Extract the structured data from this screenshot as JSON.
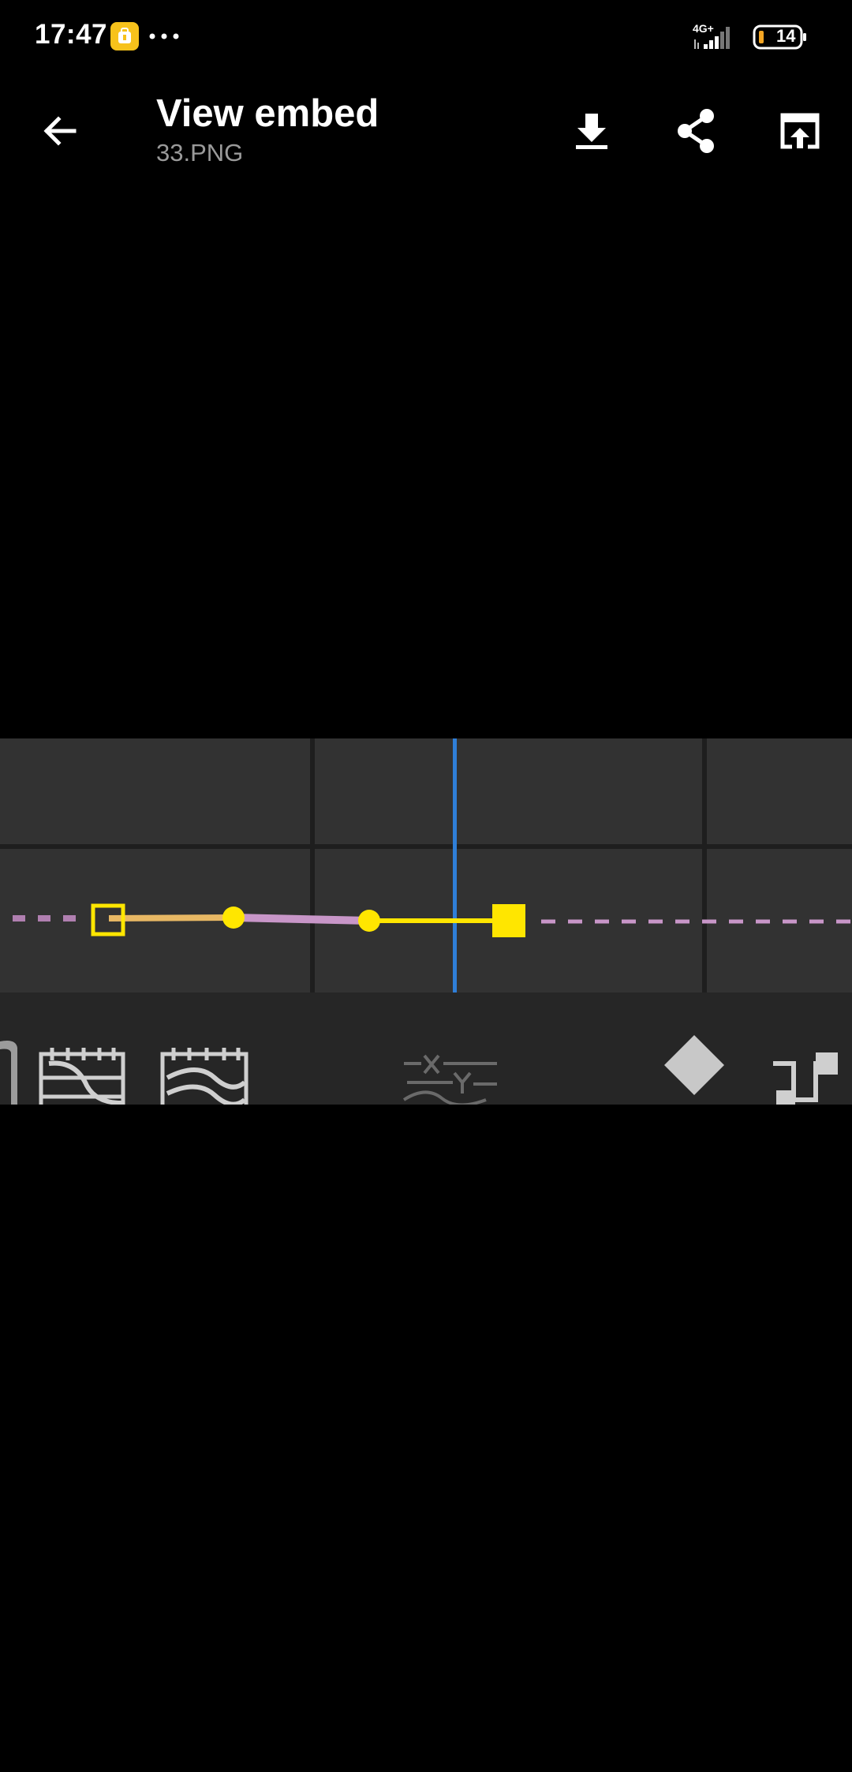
{
  "status_bar": {
    "time": "17:47",
    "network_type": "4G+",
    "battery_level": "14",
    "icons": [
      "app-notification-icon",
      "more-dots-icon",
      "signal-icon",
      "battery-icon"
    ]
  },
  "app_bar": {
    "title": "View embed",
    "subtitle": "33.PNG",
    "actions": [
      "back-arrow-icon",
      "download-icon",
      "share-icon",
      "open-external-icon"
    ]
  },
  "embed": {
    "content": "curve-editor-timeline-crop",
    "colors": {
      "background": "#000000",
      "panel": "#323232",
      "grid_line": "#1e1e1e",
      "playhead": "#2f7fd8",
      "curve_yellow": "#ffe600",
      "curve_pink": "#c896c8",
      "toolbar": "#262626",
      "toolbar_icon": "#c8c8c8"
    }
  }
}
